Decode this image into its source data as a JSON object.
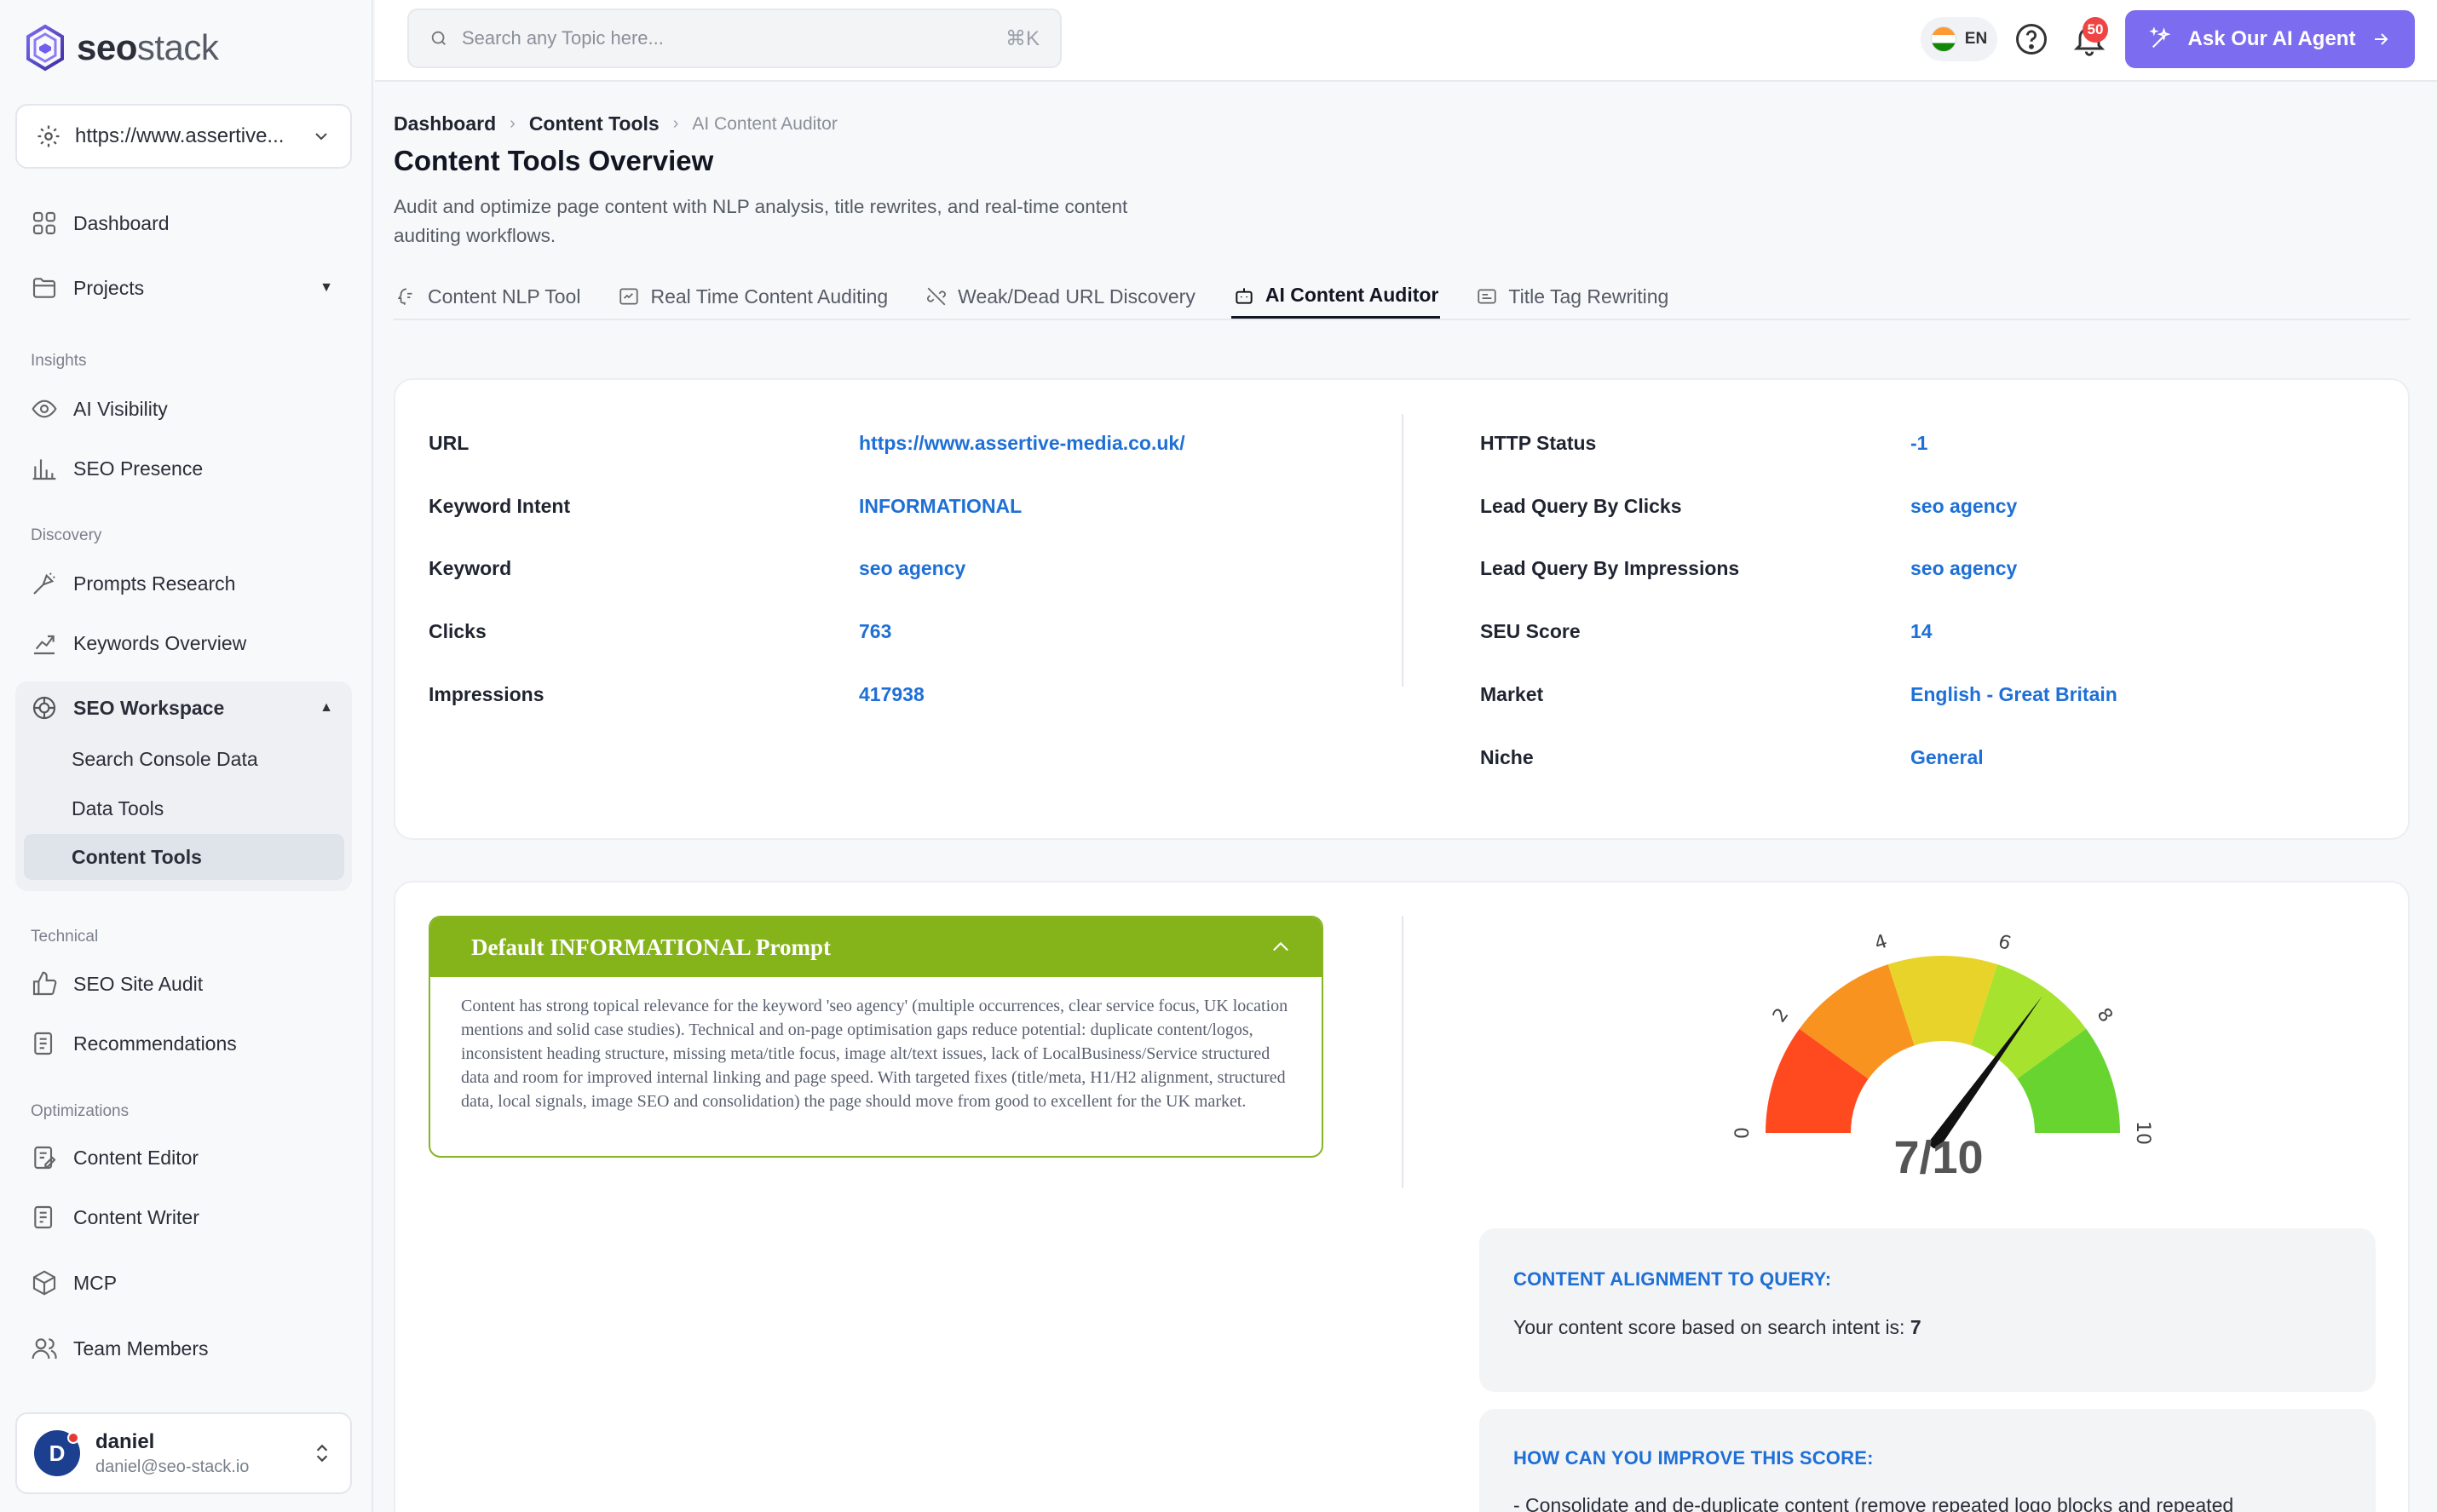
{
  "brand": {
    "seo": "seo",
    "stack": "stack"
  },
  "site_selector": {
    "value": "https://www.assertive..."
  },
  "sidebar": {
    "top_items": [
      {
        "label": "Dashboard",
        "icon": "dashboard-icon"
      },
      {
        "label": "Projects",
        "icon": "folder-icon"
      }
    ],
    "sections": {
      "insights": "Insights",
      "discovery": "Discovery",
      "technical": "Technical",
      "optimizations": "Optimizations"
    },
    "insights_items": [
      {
        "label": "AI Visibility",
        "icon": "eye-icon"
      },
      {
        "label": "SEO Presence",
        "icon": "bar-chart-icon"
      }
    ],
    "discovery_items": [
      {
        "label": "Prompts Research",
        "icon": "prompt-icon"
      },
      {
        "label": "Keywords Overview",
        "icon": "trend-icon"
      }
    ],
    "workspace": {
      "label": "SEO Workspace",
      "children": [
        "Search Console Data",
        "Data Tools",
        "Content Tools"
      ],
      "active_child": "Content Tools"
    },
    "technical_items": [
      {
        "label": "SEO Site Audit",
        "icon": "thumbs-up-icon"
      },
      {
        "label": "Recommendations",
        "icon": "report-icon"
      }
    ],
    "optimization_items": [
      {
        "label": "Content Editor",
        "icon": "edit-doc-icon"
      },
      {
        "label": "Content Writer",
        "icon": "writer-icon"
      },
      {
        "label": "MCP",
        "icon": "cube-icon"
      },
      {
        "label": "Team Members",
        "icon": "users-icon"
      }
    ],
    "user": {
      "initial": "D",
      "name": "daniel",
      "email": "daniel@seo-stack.io"
    }
  },
  "topbar": {
    "search_placeholder": "Search any Topic here...",
    "shortcut": "⌘K",
    "language": "EN",
    "notifications": "50",
    "agent_button": "Ask Our AI Agent"
  },
  "breadcrumb": {
    "root": "Dashboard",
    "parent": "Content Tools",
    "current": "AI Content Auditor"
  },
  "page": {
    "title": "Content Tools Overview",
    "description": "Audit and optimize page content with NLP analysis, title rewrites, and real-time content auditing workflows."
  },
  "tabs": [
    {
      "label": "Content NLP Tool",
      "icon": "nlp-icon"
    },
    {
      "label": "Real Time Content Auditing",
      "icon": "audit-icon"
    },
    {
      "label": "Weak/Dead URL Discovery",
      "icon": "broken-link-icon"
    },
    {
      "label": "AI Content Auditor",
      "icon": "robot-icon"
    },
    {
      "label": "Title Tag Rewriting",
      "icon": "title-icon"
    }
  ],
  "active_tab": "AI Content Auditor",
  "details_left": [
    {
      "label": "URL",
      "value": "https://www.assertive-media.co.uk/"
    },
    {
      "label": "Keyword Intent",
      "value": "INFORMATIONAL"
    },
    {
      "label": "Keyword",
      "value": "seo agency"
    },
    {
      "label": "Clicks",
      "value": "763"
    },
    {
      "label": "Impressions",
      "value": "417938"
    }
  ],
  "details_right": [
    {
      "label": "HTTP Status",
      "value": "-1"
    },
    {
      "label": "Lead Query By Clicks",
      "value": "seo agency"
    },
    {
      "label": "Lead Query By Impressions",
      "value": "seo agency"
    },
    {
      "label": "SEU Score",
      "value": "14"
    },
    {
      "label": "Market",
      "value": "English - Great Britain"
    },
    {
      "label": "Niche",
      "value": "General"
    }
  ],
  "prompt": {
    "title": "Default INFORMATIONAL Prompt",
    "body": "Content has strong topical relevance for the keyword 'seo agency' (multiple occurrences, clear service focus, UK location mentions and solid case studies). Technical and on-page optimisation gaps reduce potential: duplicate content/logos, inconsistent heading structure, missing meta/title focus, image alt/text issues, lack of LocalBusiness/Service structured data and room for improved internal linking and page speed. With targeted fixes (title/meta, H1/H2 alignment, structured data, local signals, image SEO and consolidation) the page should move from good to excellent for the UK market."
  },
  "gauge": {
    "score": 7,
    "max": 10,
    "score_label": "7/10",
    "ticks": [
      "0",
      "2",
      "4",
      "6",
      "8",
      "10"
    ],
    "colors": [
      "#ff4a1f",
      "#f7931e",
      "#e8d32a",
      "#a6e22e",
      "#67d430"
    ]
  },
  "alignment": {
    "heading": "CONTENT ALIGNMENT TO QUERY:",
    "text": "Your content score based on search intent is:",
    "score": "7"
  },
  "improve": {
    "heading": "HOW CAN YOU IMPROVE THIS SCORE:",
    "first_line": "- Consolidate and de-duplicate content (remove repeated logo blocks and repeated"
  }
}
